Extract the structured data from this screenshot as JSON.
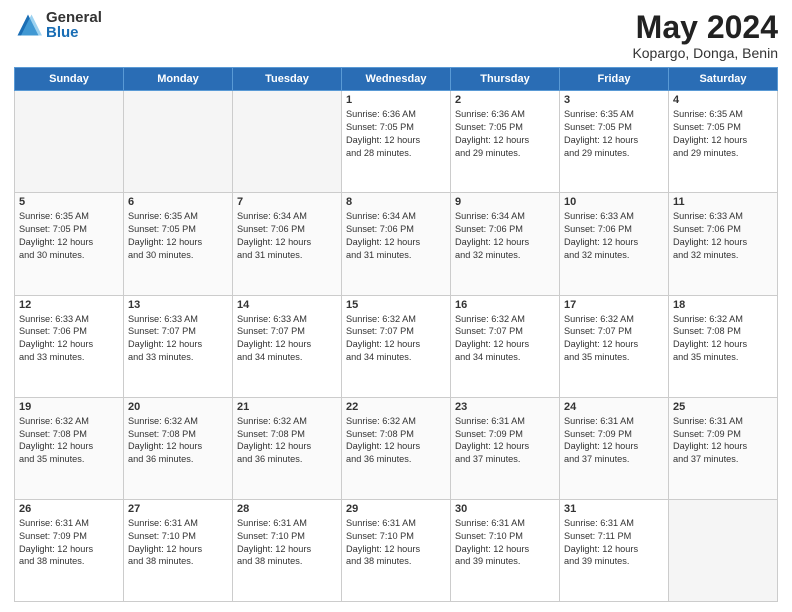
{
  "header": {
    "logo_general": "General",
    "logo_blue": "Blue",
    "title": "May 2024",
    "location": "Kopargo, Donga, Benin"
  },
  "days_of_week": [
    "Sunday",
    "Monday",
    "Tuesday",
    "Wednesday",
    "Thursday",
    "Friday",
    "Saturday"
  ],
  "weeks": [
    [
      {
        "num": "",
        "info": ""
      },
      {
        "num": "",
        "info": ""
      },
      {
        "num": "",
        "info": ""
      },
      {
        "num": "1",
        "info": "Sunrise: 6:36 AM\nSunset: 7:05 PM\nDaylight: 12 hours\nand 28 minutes."
      },
      {
        "num": "2",
        "info": "Sunrise: 6:36 AM\nSunset: 7:05 PM\nDaylight: 12 hours\nand 29 minutes."
      },
      {
        "num": "3",
        "info": "Sunrise: 6:35 AM\nSunset: 7:05 PM\nDaylight: 12 hours\nand 29 minutes."
      },
      {
        "num": "4",
        "info": "Sunrise: 6:35 AM\nSunset: 7:05 PM\nDaylight: 12 hours\nand 29 minutes."
      }
    ],
    [
      {
        "num": "5",
        "info": "Sunrise: 6:35 AM\nSunset: 7:05 PM\nDaylight: 12 hours\nand 30 minutes."
      },
      {
        "num": "6",
        "info": "Sunrise: 6:35 AM\nSunset: 7:05 PM\nDaylight: 12 hours\nand 30 minutes."
      },
      {
        "num": "7",
        "info": "Sunrise: 6:34 AM\nSunset: 7:06 PM\nDaylight: 12 hours\nand 31 minutes."
      },
      {
        "num": "8",
        "info": "Sunrise: 6:34 AM\nSunset: 7:06 PM\nDaylight: 12 hours\nand 31 minutes."
      },
      {
        "num": "9",
        "info": "Sunrise: 6:34 AM\nSunset: 7:06 PM\nDaylight: 12 hours\nand 32 minutes."
      },
      {
        "num": "10",
        "info": "Sunrise: 6:33 AM\nSunset: 7:06 PM\nDaylight: 12 hours\nand 32 minutes."
      },
      {
        "num": "11",
        "info": "Sunrise: 6:33 AM\nSunset: 7:06 PM\nDaylight: 12 hours\nand 32 minutes."
      }
    ],
    [
      {
        "num": "12",
        "info": "Sunrise: 6:33 AM\nSunset: 7:06 PM\nDaylight: 12 hours\nand 33 minutes."
      },
      {
        "num": "13",
        "info": "Sunrise: 6:33 AM\nSunset: 7:07 PM\nDaylight: 12 hours\nand 33 minutes."
      },
      {
        "num": "14",
        "info": "Sunrise: 6:33 AM\nSunset: 7:07 PM\nDaylight: 12 hours\nand 34 minutes."
      },
      {
        "num": "15",
        "info": "Sunrise: 6:32 AM\nSunset: 7:07 PM\nDaylight: 12 hours\nand 34 minutes."
      },
      {
        "num": "16",
        "info": "Sunrise: 6:32 AM\nSunset: 7:07 PM\nDaylight: 12 hours\nand 34 minutes."
      },
      {
        "num": "17",
        "info": "Sunrise: 6:32 AM\nSunset: 7:07 PM\nDaylight: 12 hours\nand 35 minutes."
      },
      {
        "num": "18",
        "info": "Sunrise: 6:32 AM\nSunset: 7:08 PM\nDaylight: 12 hours\nand 35 minutes."
      }
    ],
    [
      {
        "num": "19",
        "info": "Sunrise: 6:32 AM\nSunset: 7:08 PM\nDaylight: 12 hours\nand 35 minutes."
      },
      {
        "num": "20",
        "info": "Sunrise: 6:32 AM\nSunset: 7:08 PM\nDaylight: 12 hours\nand 36 minutes."
      },
      {
        "num": "21",
        "info": "Sunrise: 6:32 AM\nSunset: 7:08 PM\nDaylight: 12 hours\nand 36 minutes."
      },
      {
        "num": "22",
        "info": "Sunrise: 6:32 AM\nSunset: 7:08 PM\nDaylight: 12 hours\nand 36 minutes."
      },
      {
        "num": "23",
        "info": "Sunrise: 6:31 AM\nSunset: 7:09 PM\nDaylight: 12 hours\nand 37 minutes."
      },
      {
        "num": "24",
        "info": "Sunrise: 6:31 AM\nSunset: 7:09 PM\nDaylight: 12 hours\nand 37 minutes."
      },
      {
        "num": "25",
        "info": "Sunrise: 6:31 AM\nSunset: 7:09 PM\nDaylight: 12 hours\nand 37 minutes."
      }
    ],
    [
      {
        "num": "26",
        "info": "Sunrise: 6:31 AM\nSunset: 7:09 PM\nDaylight: 12 hours\nand 38 minutes."
      },
      {
        "num": "27",
        "info": "Sunrise: 6:31 AM\nSunset: 7:10 PM\nDaylight: 12 hours\nand 38 minutes."
      },
      {
        "num": "28",
        "info": "Sunrise: 6:31 AM\nSunset: 7:10 PM\nDaylight: 12 hours\nand 38 minutes."
      },
      {
        "num": "29",
        "info": "Sunrise: 6:31 AM\nSunset: 7:10 PM\nDaylight: 12 hours\nand 38 minutes."
      },
      {
        "num": "30",
        "info": "Sunrise: 6:31 AM\nSunset: 7:10 PM\nDaylight: 12 hours\nand 39 minutes."
      },
      {
        "num": "31",
        "info": "Sunrise: 6:31 AM\nSunset: 7:11 PM\nDaylight: 12 hours\nand 39 minutes."
      },
      {
        "num": "",
        "info": ""
      }
    ]
  ]
}
